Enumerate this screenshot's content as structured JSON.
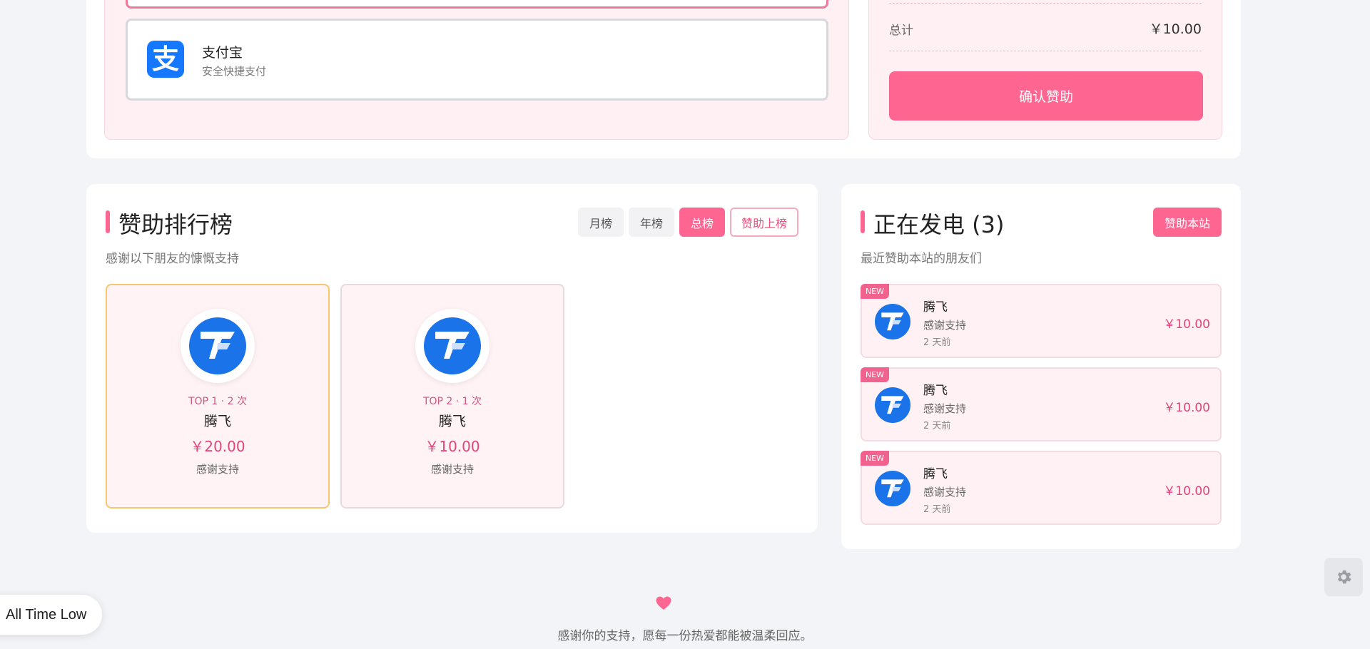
{
  "payment": {
    "method_name": "支付宝",
    "method_desc": "安全快捷支付",
    "method_icon_glyph": "支",
    "total_label": "总计",
    "total_value": "￥10.00",
    "confirm_label": "确认赞助"
  },
  "ranking": {
    "title": "赞助排行榜",
    "subtitle": "感谢以下朋友的慷慨支持",
    "tabs": [
      {
        "label": "月榜",
        "active": false
      },
      {
        "label": "年榜",
        "active": false
      },
      {
        "label": "总榜",
        "active": true
      }
    ],
    "join_label": "赞助上榜",
    "items": [
      {
        "meta": "TOP 1 · 2 次",
        "name": "腾飞",
        "amount": "￥20.00",
        "note": "感谢支持"
      },
      {
        "meta": "TOP 2 · 1 次",
        "name": "腾飞",
        "amount": "￥10.00",
        "note": "感谢支持"
      }
    ]
  },
  "live": {
    "title": "正在发电 (3)",
    "subtitle": "最近赞助本站的朋友们",
    "sponsor_label": "赞助本站",
    "badge": "NEW",
    "items": [
      {
        "name": "腾飞",
        "note": "感谢支持",
        "time": "2 天前",
        "amount": "￥10.00"
      },
      {
        "name": "腾飞",
        "note": "感谢支持",
        "time": "2 天前",
        "amount": "￥10.00"
      },
      {
        "name": "腾飞",
        "note": "感谢支持",
        "time": "2 天前",
        "amount": "￥10.00"
      }
    ]
  },
  "footer": {
    "text": "感谢你的支持，愿每一份热爱都能被温柔回应。"
  },
  "widgets": {
    "price_badge": "All Time Low",
    "settings_icon": "gear-icon"
  },
  "colors": {
    "accent": "#fe6691",
    "alipay": "#1677ff",
    "avatar_blue": "#1a73e8"
  }
}
